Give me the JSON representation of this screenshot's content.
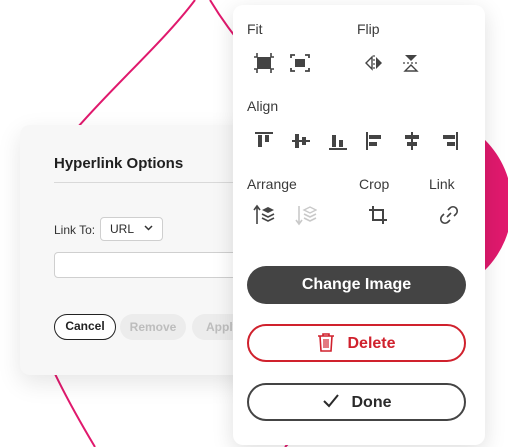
{
  "colors": {
    "accent": "#e0196d",
    "delete": "#d0212d",
    "dark_button": "#444444"
  },
  "hyperlink": {
    "title": "Hyperlink Options",
    "link_to_label": "Link To:",
    "link_type": "URL",
    "url_value": "",
    "cancel_label": "Cancel",
    "remove_label": "Remove",
    "apply_label": "Apply"
  },
  "panel": {
    "fit_label": "Fit",
    "flip_label": "Flip",
    "align_label": "Align",
    "arrange_label": "Arrange",
    "crop_label": "Crop",
    "link_label": "Link",
    "change_image_label": "Change Image",
    "delete_label": "Delete",
    "done_label": "Done"
  },
  "icons": [
    "fit-fill-icon",
    "fit-contain-icon",
    "flip-horizontal-icon",
    "flip-vertical-icon",
    "align-top-icon",
    "align-middle-icon",
    "align-bottom-icon",
    "align-left-icon",
    "align-center-icon",
    "align-right-icon",
    "bring-forward-icon",
    "send-backward-icon",
    "crop-icon",
    "link-icon",
    "trash-icon",
    "checkmark-icon",
    "chevron-down-icon"
  ]
}
